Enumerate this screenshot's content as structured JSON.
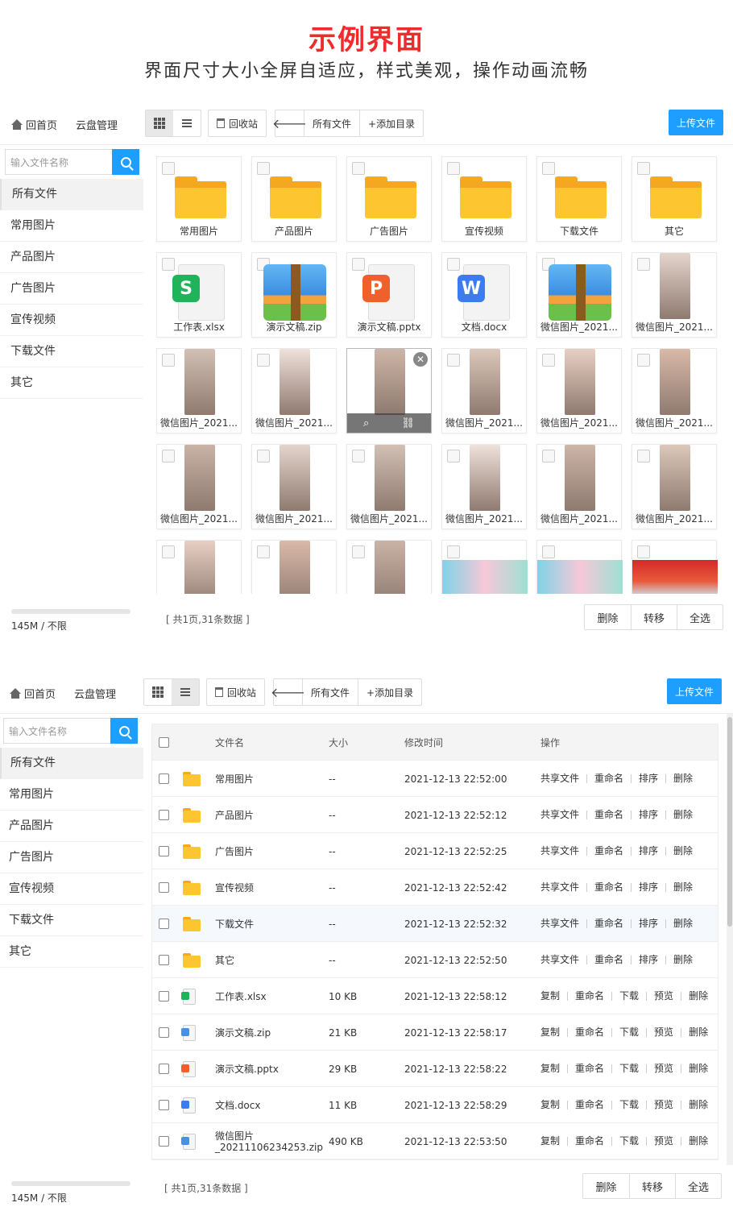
{
  "hero": {
    "title": "示例界面",
    "subtitle": "界面尺寸大小全屏自适应，样式美观，操作动画流畅"
  },
  "nav": {
    "home": "回首页",
    "cloud": "云盘管理",
    "recycle": "回收站",
    "current_path": "所有文件",
    "add_dir": "+添加目录",
    "upload": "上传文件"
  },
  "search": {
    "placeholder": "输入文件名称"
  },
  "sidebar": {
    "items": [
      {
        "label": "所有文件"
      },
      {
        "label": "常用图片"
      },
      {
        "label": "产品图片"
      },
      {
        "label": "广告图片"
      },
      {
        "label": "宣传视频"
      },
      {
        "label": "下载文件"
      },
      {
        "label": "其它"
      }
    ],
    "quota": "145M / 不限",
    "quota_used_fraction": 0
  },
  "grid_files": [
    {
      "name": "常用图片",
      "type": "folder"
    },
    {
      "name": "产品图片",
      "type": "folder"
    },
    {
      "name": "广告图片",
      "type": "folder"
    },
    {
      "name": "宣传视频",
      "type": "folder"
    },
    {
      "name": "下载文件",
      "type": "folder"
    },
    {
      "name": "其它",
      "type": "folder"
    },
    {
      "name": "工作表.xlsx",
      "type": "xlsx"
    },
    {
      "name": "演示文稿.zip",
      "type": "zip"
    },
    {
      "name": "演示文稿.pptx",
      "type": "pptx"
    },
    {
      "name": "文档.docx",
      "type": "docx"
    },
    {
      "name": "微信图片_2021...",
      "type": "zip"
    },
    {
      "name": "微信图片_2021...",
      "type": "photo"
    },
    {
      "name": "微信图片_2021...",
      "type": "photo"
    },
    {
      "name": "微信图片_2021...",
      "type": "photo"
    },
    {
      "name": "",
      "type": "photo-hover"
    },
    {
      "name": "微信图片_2021...",
      "type": "photo"
    },
    {
      "name": "微信图片_2021...",
      "type": "photo"
    },
    {
      "name": "微信图片_2021...",
      "type": "photo"
    },
    {
      "name": "微信图片_2021...",
      "type": "photo"
    },
    {
      "name": "微信图片_2021...",
      "type": "photo"
    },
    {
      "name": "微信图片_2021...",
      "type": "photo"
    },
    {
      "name": "微信图片_2021...",
      "type": "photo"
    },
    {
      "name": "微信图片_2021...",
      "type": "photo"
    },
    {
      "name": "微信图片_2021...",
      "type": "photo"
    },
    {
      "name": "",
      "type": "photo"
    },
    {
      "name": "",
      "type": "photo"
    },
    {
      "name": "",
      "type": "photo"
    },
    {
      "name": "",
      "type": "banner"
    },
    {
      "name": "",
      "type": "banner"
    },
    {
      "name": "",
      "type": "banner-red"
    }
  ],
  "footer": {
    "page_info": "[ 共1页,31条数据 ]",
    "delete": "删除",
    "move": "转移",
    "select_all": "全选"
  },
  "table": {
    "headers": {
      "name": "文件名",
      "size": "大小",
      "mtime": "修改时间",
      "ops": "操作"
    },
    "rows": [
      {
        "name": "常用图片",
        "size": "--",
        "mtime": "2021-12-13 22:52:00",
        "kind": "folder"
      },
      {
        "name": "产品图片",
        "size": "--",
        "mtime": "2021-12-13 22:52:12",
        "kind": "folder"
      },
      {
        "name": "广告图片",
        "size": "--",
        "mtime": "2021-12-13 22:52:25",
        "kind": "folder"
      },
      {
        "name": "宣传视频",
        "size": "--",
        "mtime": "2021-12-13 22:52:42",
        "kind": "folder"
      },
      {
        "name": "下载文件",
        "size": "--",
        "mtime": "2021-12-13 22:52:32",
        "kind": "folder"
      },
      {
        "name": "其它",
        "size": "--",
        "mtime": "2021-12-13 22:52:50",
        "kind": "folder"
      },
      {
        "name": "工作表.xlsx",
        "size": "10 KB",
        "mtime": "2021-12-13 22:58:12",
        "kind": "xlsx"
      },
      {
        "name": "演示文稿.zip",
        "size": "21 KB",
        "mtime": "2021-12-13 22:58:17",
        "kind": "zip"
      },
      {
        "name": "演示文稿.pptx",
        "size": "29 KB",
        "mtime": "2021-12-13 22:58:22",
        "kind": "pptx"
      },
      {
        "name": "文档.docx",
        "size": "11 KB",
        "mtime": "2021-12-13 22:58:29",
        "kind": "docx"
      },
      {
        "name": "微信图片\n_20211106234253.zip",
        "size": "490 KB",
        "mtime": "2021-12-13 22:53:50",
        "kind": "zip"
      }
    ],
    "folder_actions": [
      "共享文件",
      "重命名",
      "排序",
      "删除"
    ],
    "file_actions": [
      "复制",
      "重命名",
      "下载",
      "预览",
      "删除"
    ]
  },
  "colors": {
    "accent": "#1e9fff",
    "title_red": "#f02b2b",
    "folder": "#fdc530",
    "xlsx": "#1fb35a",
    "pptx": "#f0602b",
    "docx": "#3b7cf0"
  }
}
